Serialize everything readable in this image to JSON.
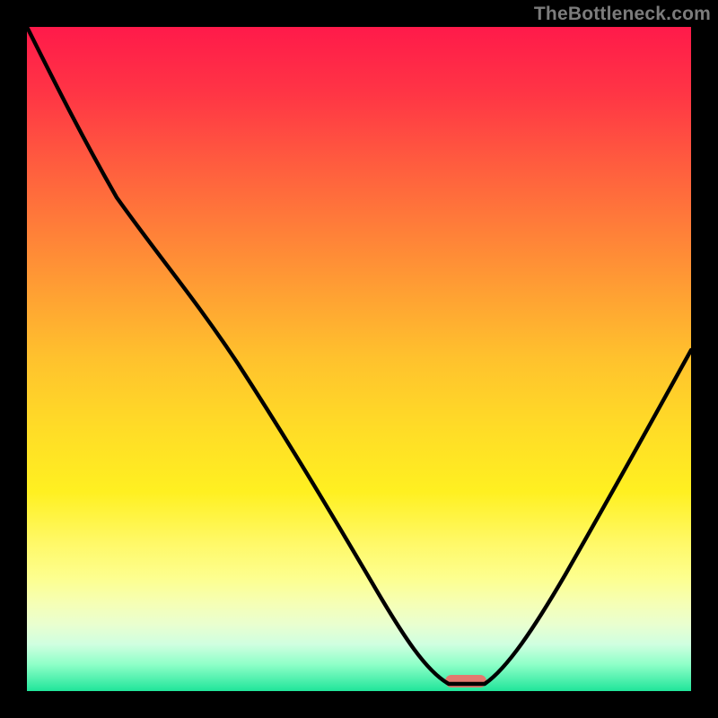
{
  "watermark": "TheBottleneck.com",
  "colors": {
    "background": "#000000",
    "curve_stroke": "#000000",
    "marker_fill": "#e27a6f",
    "gradient_stops": [
      "#ff1a4a",
      "#ff3545",
      "#ff5a3f",
      "#ff7d39",
      "#ffa033",
      "#ffc22d",
      "#ffdb27",
      "#fff021",
      "#fff96a",
      "#fdff8f",
      "#f5ffb7",
      "#e9ffd0",
      "#cfffe0",
      "#8effc8",
      "#20e59a"
    ]
  },
  "chart_data": {
    "type": "line",
    "title": "",
    "xlabel": "",
    "ylabel": "",
    "xlim": [
      0,
      100
    ],
    "ylim": [
      0,
      100
    ],
    "series": [
      {
        "name": "bottleneck-curve",
        "x": [
          0,
          6,
          12,
          18,
          24,
          32,
          40,
          48,
          54,
          58,
          62,
          65,
          68,
          72,
          78,
          84,
          90,
          96,
          100
        ],
        "values": [
          100,
          92,
          84,
          76,
          70,
          59,
          45,
          31,
          20,
          12,
          5,
          1,
          1,
          4,
          12,
          22,
          33,
          44,
          52
        ]
      }
    ],
    "marker": {
      "x": 66,
      "y": 1,
      "shape": "pill"
    }
  }
}
